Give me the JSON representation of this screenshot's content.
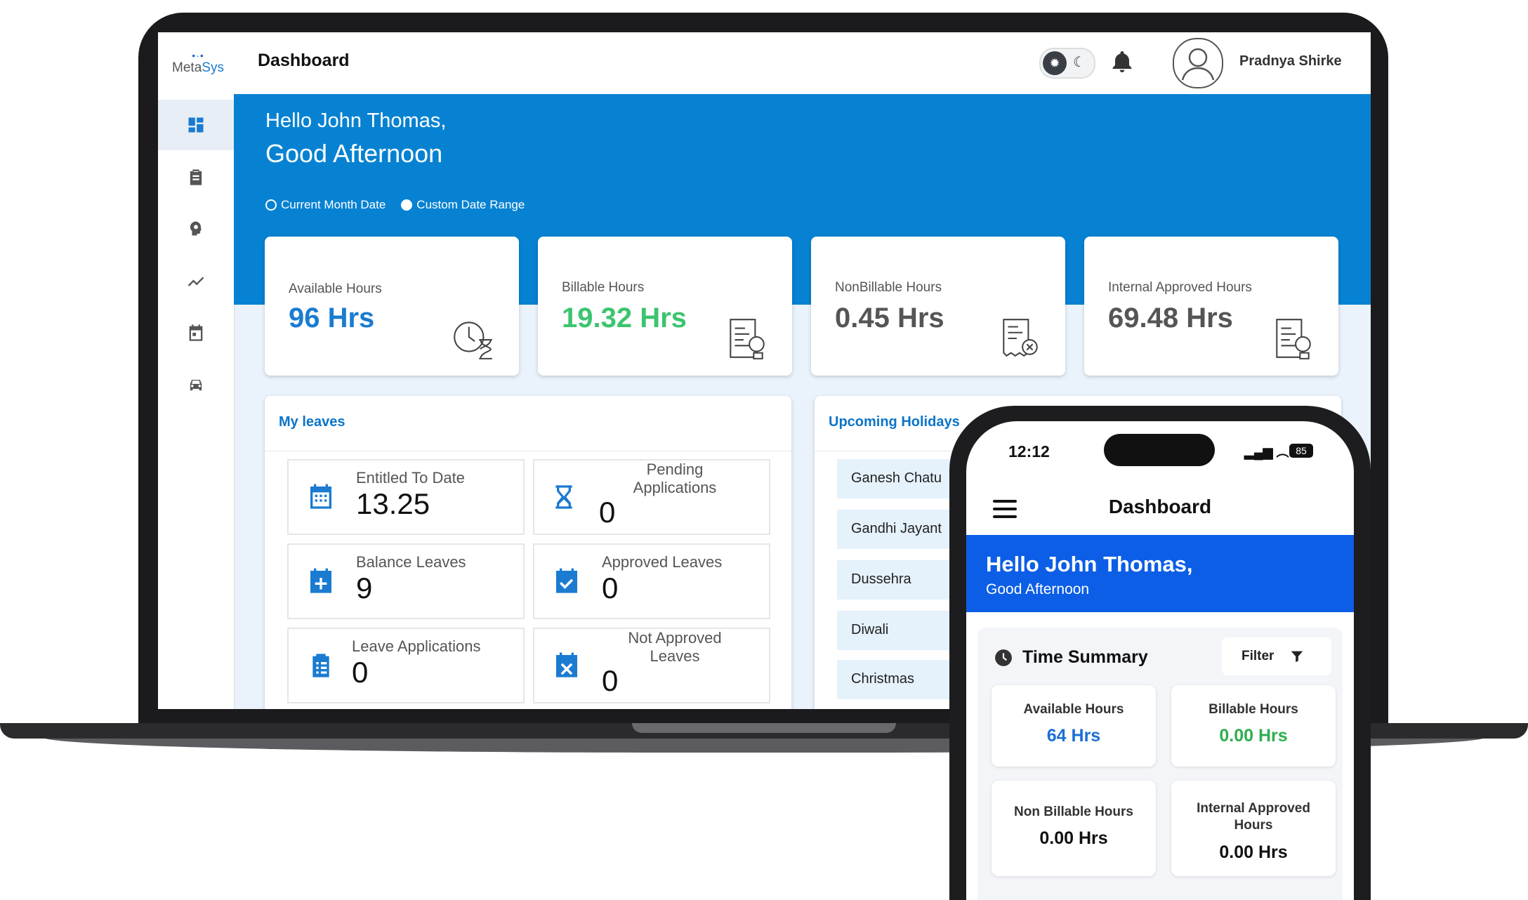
{
  "app": {
    "logo_text_a": "Meta",
    "logo_text_b": "Sys",
    "page_title": "Dashboard",
    "user_name": "Pradnya Shirke"
  },
  "sidebar": {
    "items": [
      {
        "icon": "dashboard-icon",
        "active": true
      },
      {
        "icon": "clipboard-icon",
        "active": false
      },
      {
        "icon": "settings-head-icon",
        "active": false
      },
      {
        "icon": "trend-chart-icon",
        "active": false
      },
      {
        "icon": "calendar-icon",
        "active": false
      },
      {
        "icon": "car-icon",
        "active": false
      }
    ]
  },
  "banner": {
    "greeting": "Hello John Thomas,",
    "salutation": "Good Afternoon",
    "radio_current": "Current Month Date",
    "radio_custom": "Custom Date Range"
  },
  "stats": [
    {
      "label": "Available Hours",
      "value": "96 Hrs",
      "color": "#1a7bd1"
    },
    {
      "label": "Billable Hours",
      "value": "19.32 Hrs",
      "color": "#3cc46f"
    },
    {
      "label": "NonBillable Hours",
      "value": "0.45 Hrs",
      "color": "#555555"
    },
    {
      "label": "Internal Approved Hours",
      "value": "69.48 Hrs",
      "color": "#555555"
    }
  ],
  "leaves": {
    "title": "My leaves",
    "entitled": {
      "label": "Entitled To Date",
      "value": "13.25"
    },
    "pending": {
      "label_line1": "Pending",
      "label_line2": "Applications",
      "value": "0"
    },
    "balance": {
      "label": "Balance Leaves",
      "value": "9"
    },
    "approved": {
      "label": "Approved Leaves",
      "value": "0"
    },
    "applications": {
      "label": "Leave Applications",
      "value": "0"
    },
    "not_approved": {
      "label_line1": "Not Approved",
      "label_line2": "Leaves",
      "value": "0"
    }
  },
  "holidays": {
    "title": "Upcoming Holidays",
    "items": [
      "Ganesh Chatu",
      "Gandhi Jayant",
      "Dussehra",
      "Diwali",
      "Christmas"
    ]
  },
  "phone": {
    "time": "12:12",
    "battery": "85",
    "title": "Dashboard",
    "hello": "Hello John Thomas,",
    "good": "Good Afternoon",
    "section_title": "Time Summary",
    "filter_label": "Filter",
    "cards": [
      {
        "label": "Available Hours",
        "value": "64 Hrs",
        "color": "#1a6fd6"
      },
      {
        "label": "Billable Hours",
        "value": "0.00 Hrs",
        "color": "#2fae4f"
      },
      {
        "label": "Non Billable Hours",
        "value": "0.00 Hrs",
        "color": "#111111"
      },
      {
        "label_line1": "Internal Approved",
        "label_line2": "Hours",
        "value": "0.00 Hrs",
        "color": "#111111"
      }
    ]
  },
  "colors": {
    "accent_blue": "#0782d2",
    "phone_banner": "#0c5ee6",
    "screen_bg": "#eaf3fb"
  }
}
